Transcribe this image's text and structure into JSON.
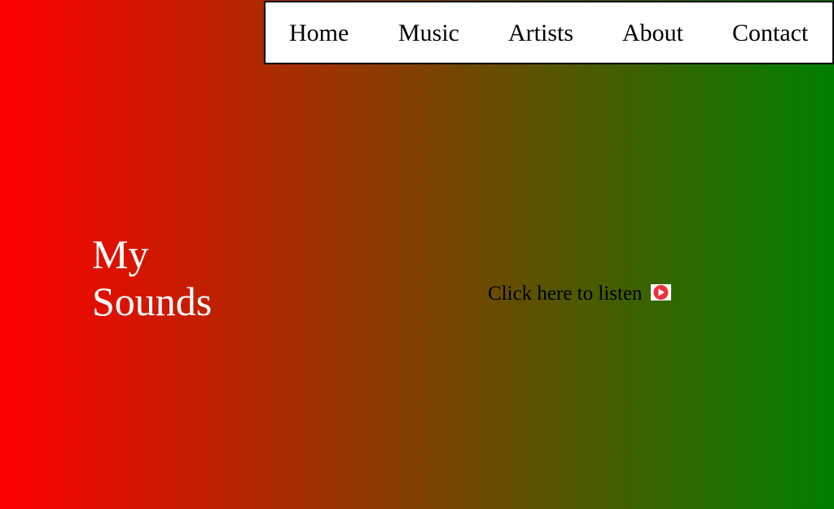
{
  "nav": {
    "items": [
      {
        "label": "Home"
      },
      {
        "label": "Music"
      },
      {
        "label": "Artists"
      },
      {
        "label": "About"
      },
      {
        "label": "Contact"
      }
    ]
  },
  "hero": {
    "title_line1": "My",
    "title_line2": "Sounds"
  },
  "listen": {
    "label": "Click here to listen",
    "icon": "play-icon"
  },
  "colors": {
    "gradient_start": "#ff0000",
    "gradient_end": "#008000",
    "nav_background": "#ffffff",
    "title_color": "#ffffff",
    "play_icon_color": "#e8333c"
  }
}
